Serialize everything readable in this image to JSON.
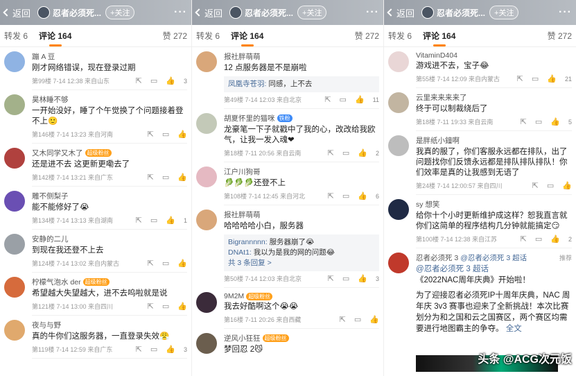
{
  "panels": [
    {
      "header": {
        "back": "返回",
        "title": "忍者必须死...",
        "follow": "+关注"
      },
      "tabs": {
        "repost": "转发 6",
        "comments": "评论 164",
        "likes": "赞 272"
      },
      "comments": [
        {
          "name": "蹦 A 豆",
          "text": "刚才网络错误，现在登录过期",
          "meta": "第99楼 7-14 12:38 来自山东",
          "likes": "3",
          "avatar_color": "#8fb3e3"
        },
        {
          "name": "昊林睡不够",
          "text": "一开始没好，睡了个午觉换了个问题接着登不上🙂",
          "meta": "第146楼 7-14 13:23 来自河南",
          "likes": "",
          "avatar_color": "#a3b18a"
        },
        {
          "name": "又木同学又木了",
          "badge": "超级粉丝",
          "text": "还是进不去 这更新更嘞去了",
          "meta": "第142楼 7-14 13:21 来自广东",
          "likes": "",
          "avatar_color": "#b0413e"
        },
        {
          "name": "雕不侧梨子",
          "text": "能不能修好了😭",
          "meta": "第134楼 7-14 13:13 来自湖南",
          "likes": "1",
          "avatar_color": "#6a4fb3"
        },
        {
          "name": "安静的二儿",
          "text": "到现在我还登不上去",
          "meta": "第124楼 7-14 13:02 来自内蒙古",
          "likes": "",
          "avatar_color": "#9aa0a6"
        },
        {
          "name": "柠檬气泡水 der",
          "badge": "超级粉丝",
          "text": "希望越大失望越大，进不去呜啦就是说",
          "meta": "第121楼 7-14 13:00 来自四川",
          "likes": "",
          "avatar_color": "#d66b3c"
        },
        {
          "name": "夜与与野",
          "text": "真的牛你们这服务器，一直登录失效😤",
          "meta": "第119楼 7-14 12:59 来自广东",
          "likes": "3",
          "avatar_color": "#e0a96d"
        }
      ]
    },
    {
      "header": {
        "back": "返回",
        "title": "忍者必须死...",
        "follow": "+关注"
      },
      "tabs": {
        "repost": "转发 6",
        "comments": "评论 164",
        "likes": "赞 272"
      },
      "comments": [
        {
          "name": "报社胖萌萌",
          "text": "12 点服务器是不是崩啦",
          "meta": "第49楼 7-14 12:03 来自北京",
          "likes": "11",
          "avatar_color": "#d9a77a",
          "reply": {
            "name": "凤凰寺苍羽:",
            "text": "同感，上不去"
          }
        },
        {
          "name": "胡夏怀里的猫咪",
          "badge": "铁粉",
          "text": "龙豪笔一下子就戳中了我的心，改改给我欧气，让我一发入魂❤",
          "meta": "第18楼 7-11 20:56 来自云南",
          "likes": "2",
          "avatar_color": "#c3c9b8"
        },
        {
          "name": "江户川狗哥",
          "text": "🥬🥬🥬还登不上",
          "meta": "第108楼 7-14 12:45 来自河北",
          "likes": "6",
          "avatar_color": "#e5b9c2"
        },
        {
          "name": "报社胖萌萌",
          "text": "哈哈哈哈小白，服务器",
          "meta": "第50楼 7-14 12:03 来自北京",
          "likes": "3",
          "avatar_color": "#d9a77a",
          "replies": [
            {
              "name": "Bigrannnnn:",
              "text": "服务器崩了😭"
            },
            {
              "name": "DNAt1:",
              "text": "我以为是我的网的问题😂"
            }
          ],
          "reply_more": "共 3 条回复 >"
        },
        {
          "name": "9M2M",
          "badge": "超级粉丝",
          "text": "我去好酷啊这个😭😭",
          "meta": "第16楼 7-11 20:26 来自西藏",
          "likes": "",
          "avatar_color": "#3b2b3a"
        },
        {
          "name": "逆风小狂狂",
          "badge": "超级粉丝",
          "text": "梦回忍 2😼",
          "meta": "",
          "likes": "",
          "avatar_color": "#6b5e4e"
        }
      ]
    },
    {
      "header": {
        "back": "返回",
        "title": "忍者必须死...",
        "follow": "+关注"
      },
      "tabs": {
        "repost": "转发 6",
        "comments": "评论 164",
        "likes": "赞 272"
      },
      "comments": [
        {
          "name": "VitaminD404",
          "text": "游戏进不去，宝子😂",
          "meta": "第55楼 7-14 12:09 来自内蒙古",
          "likes": "21",
          "avatar_color": "#e9d6d6"
        },
        {
          "name": "云里来来来来了",
          "text": "终于可以制裁绕后了",
          "meta": "第18楼 7-11 19:33 来自云南",
          "likes": "5",
          "avatar_color": "#c2b5a1"
        },
        {
          "name": "是胖纸小鐘啊",
          "text": "我真的服了，你们客服永远都在排队，出了问题找你们反馈永远都是排队排队排队！你们效率是真的让我感到无语了",
          "meta": "第24楼 7-14 12:00:57 来自四川",
          "likes": "",
          "avatar_color": "#bdbdbd"
        },
        {
          "name": "sy 想笑",
          "text": "给你十个小时更新维护成这样？恕我直言就你们这简单的程序结构几分钟就能搞定😏",
          "meta": "第100楼 7-14 12:38 来自江苏",
          "likes": "2",
          "avatar_color": "#1f2a44"
        }
      ],
      "post": {
        "author": "忍者必须死 3",
        "retweet": "@忍者必须死 3 超话",
        "super": "@忍者必须死 3 超话",
        "recommend": "推荐",
        "title": "《2022NAC周年庆典》开始啦！",
        "body": "为了迎接忍者必须死IP十周年庆典，NAC 周年庆 3v3 赛事也迎来了全新挑战！本次比赛划分为和之国和云之国赛区，两个赛区均需要进行地图霸主的争夺。",
        "more": "全文",
        "avatar_color": "#c0392b"
      },
      "watermark": "头条 @ACG次元饭"
    }
  ]
}
